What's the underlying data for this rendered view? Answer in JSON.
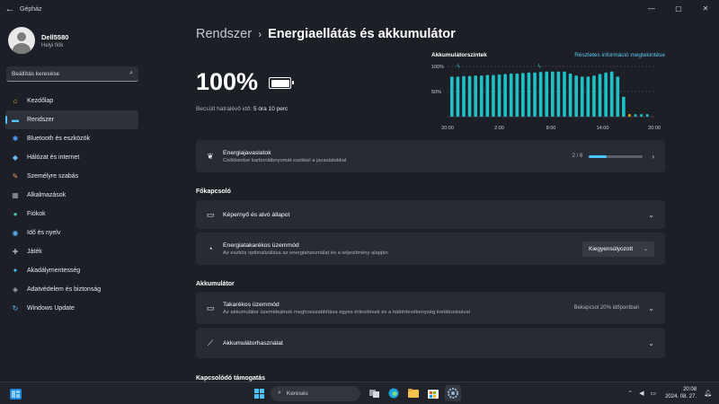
{
  "window": {
    "title": "Gépház",
    "back": "←",
    "minimize": "—",
    "maximize": "▢",
    "close": "✕"
  },
  "profile": {
    "name": "Dell5580",
    "type": "Helyi fiók"
  },
  "search": {
    "placeholder": "Beállítás keresése"
  },
  "nav": [
    {
      "label": "Kezdőlap",
      "icon": "home-icon",
      "glyph": "⌂",
      "color": "#e0a44d"
    },
    {
      "label": "Rendszer",
      "icon": "monitor-icon",
      "glyph": "▬",
      "color": "#4cc2ff",
      "active": true
    },
    {
      "label": "Bluetooth és eszközök",
      "icon": "bluetooth-icon",
      "glyph": "✱",
      "color": "#4ca0ff"
    },
    {
      "label": "Hálózat és internet",
      "icon": "wifi-icon",
      "glyph": "◆",
      "color": "#6ab7ff"
    },
    {
      "label": "Személyre szabás",
      "icon": "brush-icon",
      "glyph": "✎",
      "color": "#e9a060"
    },
    {
      "label": "Alkalmazások",
      "icon": "apps-icon",
      "glyph": "▦",
      "color": "#a0a8b4"
    },
    {
      "label": "Fiókok",
      "icon": "person-icon",
      "glyph": "●",
      "color": "#3fc6a0"
    },
    {
      "label": "Idő és nyelv",
      "icon": "globe-icon",
      "glyph": "◉",
      "color": "#5bb0ff"
    },
    {
      "label": "Játék",
      "icon": "gamepad-icon",
      "glyph": "✚",
      "color": "#a0a8b4"
    },
    {
      "label": "Akadálymentesség",
      "icon": "accessibility-icon",
      "glyph": "✦",
      "color": "#4cc2ff"
    },
    {
      "label": "Adatvédelem és biztonság",
      "icon": "shield-icon",
      "glyph": "◈",
      "color": "#a0a8b4"
    },
    {
      "label": "Windows Update",
      "icon": "update-icon",
      "glyph": "↻",
      "color": "#4cc2ff"
    }
  ],
  "breadcrumb": {
    "parent": "Rendszer",
    "separator": "›",
    "current": "Energiaellátás és akkumulátor"
  },
  "battery": {
    "percent": "100%",
    "remaining_label": "Becsült hátralévő idő:",
    "remaining_value": "5 óra 10 perc",
    "level": 1.0
  },
  "chart_data": {
    "type": "bar",
    "title": "Akkumulátorszintek",
    "link": "Részletes információ megtekintése",
    "yticks": [
      "100%",
      "50%"
    ],
    "xticks": [
      "20:00",
      "2:00",
      "8:00",
      "14:00",
      "20:00"
    ],
    "ylim": [
      0,
      100
    ],
    "values": [
      80,
      80,
      81,
      81,
      82,
      82,
      83,
      83,
      84,
      85,
      86,
      86,
      87,
      88,
      88,
      89,
      90,
      90,
      90,
      90,
      86,
      82,
      80,
      80,
      82,
      85,
      88,
      90,
      80,
      40
    ],
    "dots": 4,
    "colors": {
      "bar": "#20c0c8",
      "dot": "#20c0c8",
      "accent": "#e0a000",
      "grid": "#5a606a"
    }
  },
  "energy": {
    "title": "Energiajavaslatok",
    "sub": "Csökkentse karbonlábnyomát ezekkel a javaslatokkal",
    "count": "2 / 6",
    "progress": 0.33
  },
  "sections": {
    "power": "Főkapcsoló",
    "battery": "Akkumulátor",
    "related": "Kapcsolódó támogatás"
  },
  "screen": {
    "title": "Képernyő és alvó állapot"
  },
  "powermode": {
    "title": "Energiatakarékos üzemmód",
    "sub": "Az eszköz optimalizálása az energiahasználat és a teljesítmény alapján",
    "value": "Kiegyensúlyozott"
  },
  "saver": {
    "title": "Takarékos üzemmód",
    "sub": "Az akkumulátor üzemidejének meghosszabbítása egyes értesítések és a háttértevékenység korlátozásával",
    "status": "Bekapcsol 20% időpontban"
  },
  "usage": {
    "title": "Akkumulátorhasználat"
  },
  "taskbar": {
    "search": "Keresés",
    "time": "20:08",
    "date": "2024. 08. 27."
  }
}
